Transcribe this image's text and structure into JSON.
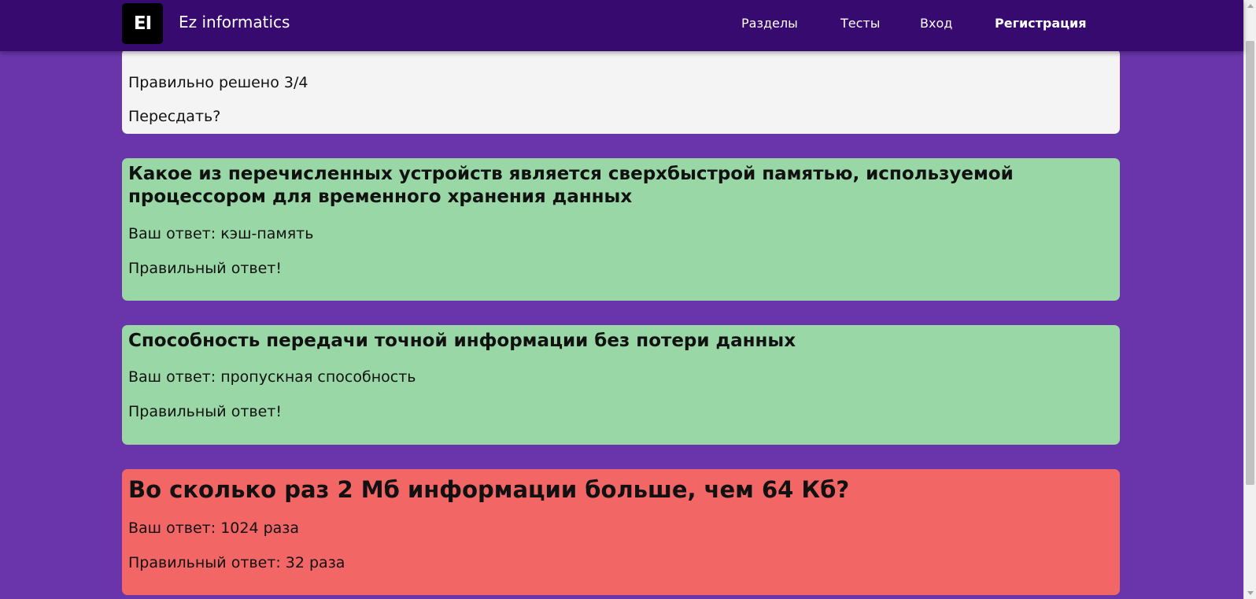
{
  "nav": {
    "logo_text": "EI",
    "brand": "Ez informatics",
    "links": [
      "Разделы",
      "Тесты",
      "Вход",
      "Регистрация"
    ]
  },
  "summary": {
    "score_text": "Правильно решено 3/4",
    "retake_text": "Пересдать?"
  },
  "questions": [
    {
      "question": "Какое из перечисленных устройств является сверхбыстрой памятью, используемой процессором для временного хранения данных",
      "your_answer": "Ваш ответ: кэш-память",
      "result": "Правильный ответ!",
      "status": "correct"
    },
    {
      "question": "Способность передачи точной информации без потери данных",
      "your_answer": "Ваш ответ: пропускная способность",
      "result": "Правильный ответ!",
      "status": "correct"
    },
    {
      "question": "Во сколько раз 2 Мб информации больше, чем 64 Кб?",
      "your_answer": "Ваш ответ: 1024 раза",
      "result": "Правильный ответ: 32 раза",
      "status": "incorrect"
    }
  ],
  "colors": {
    "page_background": "#6a35aa",
    "navbar": "#360a6e",
    "summary_card": "#f4f4f4",
    "correct_card": "#99d8a6",
    "incorrect_card": "#f26666"
  }
}
